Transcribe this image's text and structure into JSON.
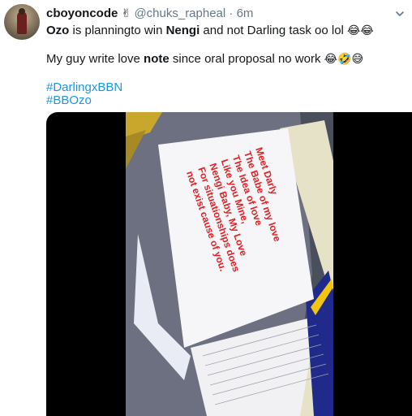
{
  "tweet": {
    "display_name": "cboyoncode",
    "name_emoji": "✌",
    "handle": "@chuks_rapheal",
    "separator": "·",
    "time": "6m",
    "line1": {
      "p1": "Ozo",
      "p2": " is planningto win ",
      "p3": "Nengi",
      "p4": " and not Darling task oo lol ",
      "emoji": "😂😂"
    },
    "line2": {
      "p1": "My guy write love ",
      "p2": "note",
      "p3": " since oral proposal no work ",
      "emoji": "😂🤣😅"
    },
    "hashtags": [
      "#DarlingxBBN",
      "#BBOzo"
    ]
  },
  "media": {
    "note_lines": [
      "Meet Darly",
      "The Babe of my love",
      "The Idea of love",
      "Like you Mine,",
      "Nengi Baby, My Love",
      "For situationships does",
      "not exist cause of you."
    ]
  },
  "colors": {
    "link": "#1b95e0",
    "muted": "#657786",
    "text": "#14171a",
    "ink": "#e01f24"
  }
}
